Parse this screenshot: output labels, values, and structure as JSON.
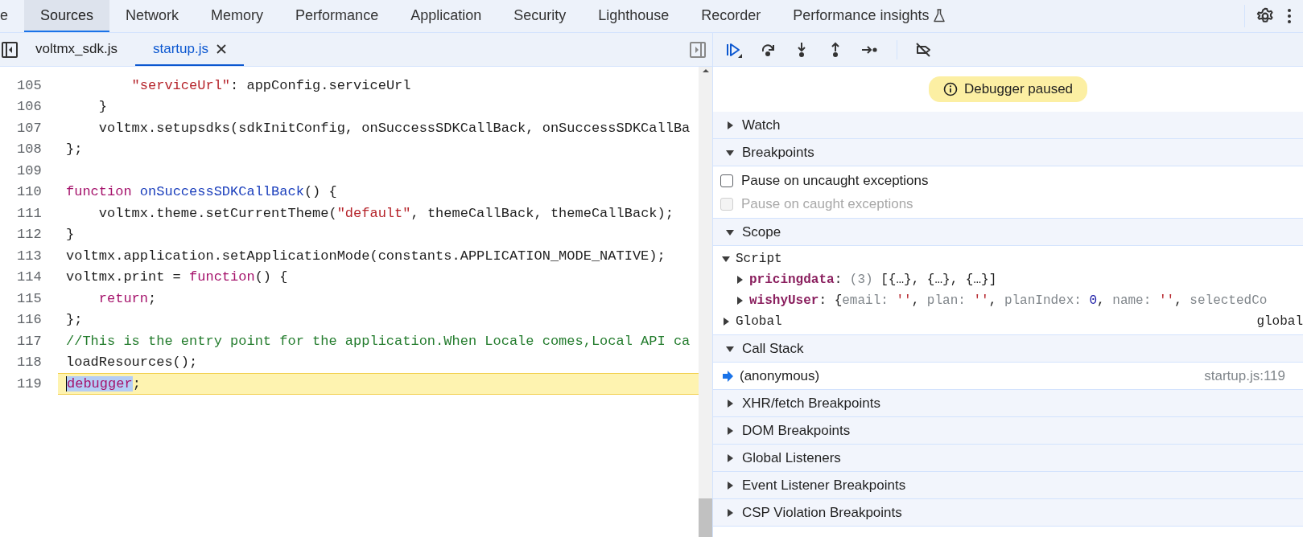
{
  "tabs": [
    {
      "label": "e",
      "selected": false,
      "kind": "panel"
    },
    {
      "label": "Sources",
      "selected": true,
      "kind": "panel"
    },
    {
      "label": "Network",
      "selected": false,
      "kind": "panel"
    },
    {
      "label": "Memory",
      "selected": false,
      "kind": "panel"
    },
    {
      "label": "Performance",
      "selected": false,
      "kind": "panel"
    },
    {
      "label": "Application",
      "selected": false,
      "kind": "panel"
    },
    {
      "label": "Security",
      "selected": false,
      "kind": "panel"
    },
    {
      "label": "Lighthouse",
      "selected": false,
      "kind": "panel"
    },
    {
      "label": "Recorder",
      "selected": false,
      "kind": "panel"
    },
    {
      "label": "Performance insights",
      "selected": false,
      "kind": "experimental"
    }
  ],
  "file_tabs": [
    {
      "label": "voltmx_sdk.js",
      "selected": false,
      "closable": false
    },
    {
      "label": "startup.js",
      "selected": true,
      "closable": true
    }
  ],
  "code": {
    "lines": [
      {
        "number": "105",
        "paused": false,
        "tokens": [
          {
            "text": "        \"serviceUrl\"",
            "kind": "string"
          },
          {
            "text": ": appConfig.serviceUrl",
            "kind": "plain"
          }
        ]
      },
      {
        "number": "106",
        "paused": false,
        "tokens": [
          {
            "text": "    }",
            "kind": "plain"
          }
        ]
      },
      {
        "number": "107",
        "paused": false,
        "tokens": [
          {
            "text": "    voltmx.setupsdks(sdkInitConfig, onSuccessSDKCallBack, onSuccessSDKCallBa",
            "kind": "plain"
          }
        ]
      },
      {
        "number": "108",
        "paused": false,
        "tokens": [
          {
            "text": "};",
            "kind": "plain"
          }
        ]
      },
      {
        "number": "109",
        "paused": false
      },
      {
        "number": "110",
        "paused": false,
        "tokens": [
          {
            "text": "function ",
            "kind": "keyword"
          },
          {
            "text": "onSuccessSDKCallBack",
            "kind": "function"
          },
          {
            "text": "() {",
            "kind": "plain"
          }
        ]
      },
      {
        "number": "111",
        "paused": false,
        "tokens": [
          {
            "text": "    voltmx.theme.setCurrentTheme(",
            "kind": "plain"
          },
          {
            "text": "\"default\"",
            "kind": "string"
          },
          {
            "text": ", themeCallBack, themeCallBack);",
            "kind": "plain"
          }
        ]
      },
      {
        "number": "112",
        "paused": false,
        "tokens": [
          {
            "text": "}",
            "kind": "plain"
          }
        ]
      },
      {
        "number": "113",
        "paused": false,
        "tokens": [
          {
            "text": "voltmx.application.setApplicationMode(constants.APPLICATION_MODE_NATIVE);",
            "kind": "plain"
          }
        ]
      },
      {
        "number": "114",
        "paused": false,
        "tokens": [
          {
            "text": "voltmx.print = ",
            "kind": "plain"
          },
          {
            "text": "function",
            "kind": "keyword"
          },
          {
            "text": "() {",
            "kind": "plain"
          }
        ]
      },
      {
        "number": "115",
        "paused": false,
        "tokens": [
          {
            "text": "    return",
            "kind": "keyword"
          },
          {
            "text": ";",
            "kind": "plain"
          }
        ]
      },
      {
        "number": "116",
        "paused": false,
        "tokens": [
          {
            "text": "};",
            "kind": "plain"
          }
        ]
      },
      {
        "number": "117",
        "paused": false,
        "tokens": [
          {
            "text": "//This is the entry point for the application.When Locale comes,Local API ca",
            "kind": "comment"
          }
        ]
      },
      {
        "number": "118",
        "paused": false,
        "tokens": [
          {
            "text": "loadResources();",
            "kind": "plain"
          }
        ]
      },
      {
        "number": "119",
        "paused": true,
        "tokens": [
          {
            "text": "debugger",
            "kind": "selection"
          },
          {
            "text": ";",
            "kind": "plain"
          }
        ]
      }
    ]
  },
  "status_badge": "Debugger paused",
  "sections": [
    {
      "title": "Watch",
      "expanded": false
    },
    {
      "title": "Breakpoints",
      "expanded": true,
      "kind": "breakpoints",
      "options": [
        {
          "label": "Pause on uncaught exceptions",
          "checked": false,
          "disabled": false
        },
        {
          "label": "Pause on caught exceptions",
          "checked": false,
          "disabled": true
        }
      ]
    },
    {
      "title": "Scope",
      "expanded": true,
      "kind": "scope",
      "nodes": [
        {
          "name": "Script",
          "kind": "scope",
          "expanded": true,
          "children": [
            {
              "name": "pricingdata",
              "kind": "variable",
              "expanded": false,
              "value": [
                {
                  "text": ": ",
                  "kind": "plain"
                },
                {
                  "text": "(3)",
                  "kind": "dim"
                },
                {
                  "text": " [{…}, {…}, {…}]",
                  "kind": "plain"
                }
              ]
            },
            {
              "name": "wishyUser",
              "kind": "variable",
              "expanded": false,
              "value": [
                {
                  "text": ": {",
                  "kind": "plain"
                },
                {
                  "text": "email: ",
                  "kind": "dim"
                },
                {
                  "text": "''",
                  "kind": "string"
                },
                {
                  "text": ", ",
                  "kind": "plain"
                },
                {
                  "text": "plan: ",
                  "kind": "dim"
                },
                {
                  "text": "''",
                  "kind": "string"
                },
                {
                  "text": ", ",
                  "kind": "plain"
                },
                {
                  "text": "planIndex: ",
                  "kind": "dim"
                },
                {
                  "text": "0",
                  "kind": "number"
                },
                {
                  "text": ", ",
                  "kind": "plain"
                },
                {
                  "text": "name: ",
                  "kind": "dim"
                },
                {
                  "text": "''",
                  "kind": "string"
                },
                {
                  "text": ", ",
                  "kind": "plain"
                },
                {
                  "text": "selectedCo",
                  "kind": "dim"
                }
              ]
            }
          ]
        },
        {
          "name": "Global",
          "kind": "scope",
          "expanded": false,
          "summary": "global"
        }
      ]
    },
    {
      "title": "Call Stack",
      "expanded": true,
      "kind": "callstack",
      "frames": [
        {
          "name": "(anonymous)",
          "location": "startup.js:119",
          "selected": true
        }
      ]
    },
    {
      "title": "XHR/fetch Breakpoints",
      "expanded": false
    },
    {
      "title": "DOM Breakpoints",
      "expanded": false
    },
    {
      "title": "Global Listeners",
      "expanded": false
    },
    {
      "title": "Event Listener Breakpoints",
      "expanded": false
    },
    {
      "title": "CSP Violation Breakpoints",
      "expanded": false
    }
  ]
}
